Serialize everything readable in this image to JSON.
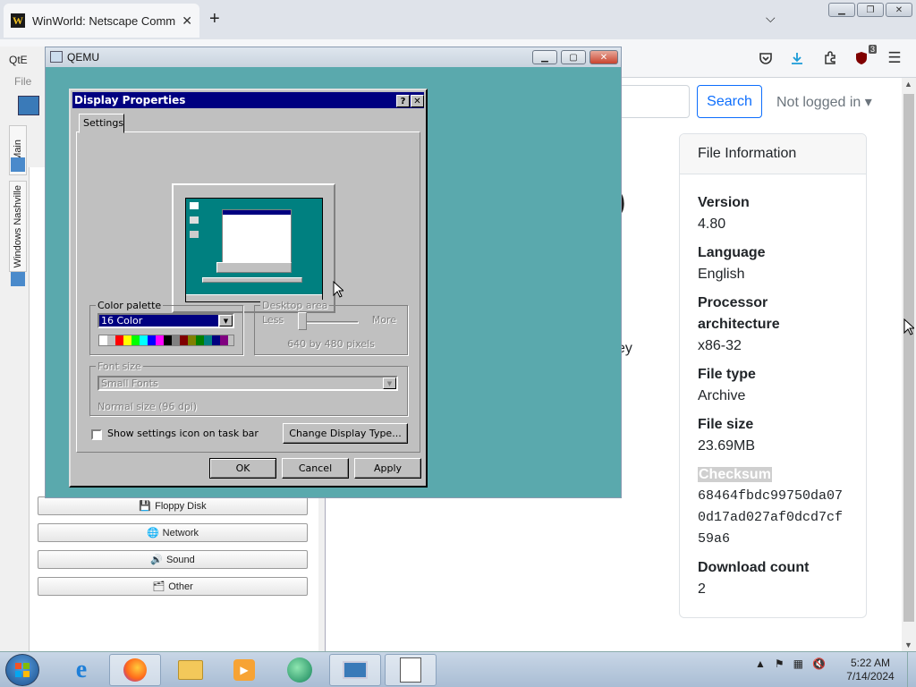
{
  "browser": {
    "tab_title": "WinWorld: Netscape Communi",
    "favicon_letter": "W",
    "new_tab": "+",
    "tab_list": "⌵",
    "close": "✕",
    "nav_icons": [
      "pocket-icon",
      "downloads-icon",
      "extensions-icon",
      "ublock-icon",
      "menu-icon"
    ],
    "badge_count": "3"
  },
  "page": {
    "search_button": "Search",
    "login": "Not logged in ▾",
    "partial_paren": ")",
    "partial_text": "ey",
    "file_info": {
      "header": "File Information",
      "version_label": "Version",
      "version_value": "4.80",
      "language_label": "Language",
      "language_value": "English",
      "arch_label": "Processor architecture",
      "arch_value": "x86-32",
      "type_label": "File type",
      "type_value": "Archive",
      "size_label": "File size",
      "size_value": "23.69MB",
      "checksum_label": "Checksum",
      "checksum_value": "68464fbdc99750da070d17ad027af0dcd7cf59a6",
      "downloads_label": "Download count",
      "downloads_value": "2"
    }
  },
  "qtemu": {
    "title": "QtE",
    "menu_file": "File",
    "tab_main": "Main",
    "tab_machine": "Windows Nashville",
    "buttons": [
      "Floppy Disk",
      "Network",
      "Sound",
      "Other"
    ]
  },
  "qemu": {
    "title": "QEMU"
  },
  "dialog": {
    "title": "Display Properties",
    "help": "?",
    "close": "✕",
    "tab": "Settings",
    "color_palette_label": "Color palette",
    "color_palette_value": "16 Color",
    "desktop_area_label": "Desktop area",
    "less": "Less",
    "more": "More",
    "resolution": "640 by 480 pixels",
    "font_size_label": "Font size",
    "font_size_value": "Small Fonts",
    "font_size_note": "Normal size (96 dpi)",
    "show_icon_label": "Show settings icon on task bar",
    "show_icon_checked": false,
    "change_display_type": "Change Display Type...",
    "ok": "OK",
    "cancel": "Cancel",
    "apply": "Apply",
    "swatches": [
      "#ffffff",
      "#c0c0c0",
      "#ff0000",
      "#ffff00",
      "#00ff00",
      "#00ffff",
      "#0000ff",
      "#ff00ff",
      "#000000",
      "#808080",
      "#800000",
      "#808000",
      "#008000",
      "#008080",
      "#000080",
      "#800080"
    ]
  },
  "taskbar": {
    "time": "5:22 AM",
    "date": "7/14/2024",
    "tray_chevron": "▲"
  },
  "colors": {
    "qemu_bg": "#5aa9ad",
    "win95_face": "#c0c0c0",
    "win95_title": "#000080",
    "link_blue": "#0d6efd"
  }
}
